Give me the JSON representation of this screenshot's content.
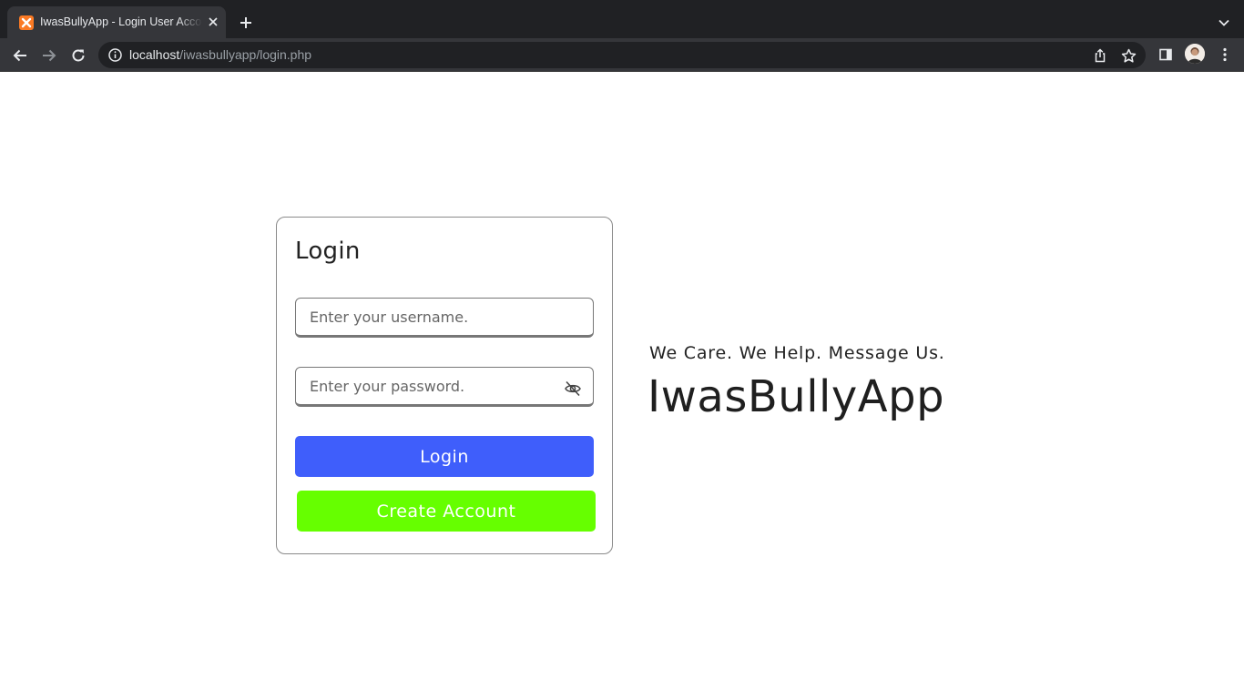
{
  "browser": {
    "tab_title": "IwasBullyApp - Login User Account",
    "url_host": "localhost",
    "url_path": "/iwasbullyapp/login.php"
  },
  "login_card": {
    "title": "Login",
    "username_placeholder": "Enter your username.",
    "password_placeholder": "Enter your password.",
    "login_label": "Login",
    "create_account_label": "Create Account"
  },
  "hero": {
    "tagline": "We Care. We Help. Message Us.",
    "brand": "IwasBullyApp"
  },
  "colors": {
    "login_button": "#3f5efb",
    "create_account_button": "#66ff00",
    "favicon": "#fb7a24"
  },
  "icons": {
    "favicon": "xampp-icon",
    "password_toggle": "eye-slash-icon",
    "back": "arrow-left-icon",
    "forward": "arrow-right-icon",
    "reload": "reload-icon",
    "site_info": "info-icon",
    "share": "share-icon",
    "bookmark": "star-icon",
    "side_panel": "side-panel-icon",
    "menu": "kebab-menu-icon"
  }
}
